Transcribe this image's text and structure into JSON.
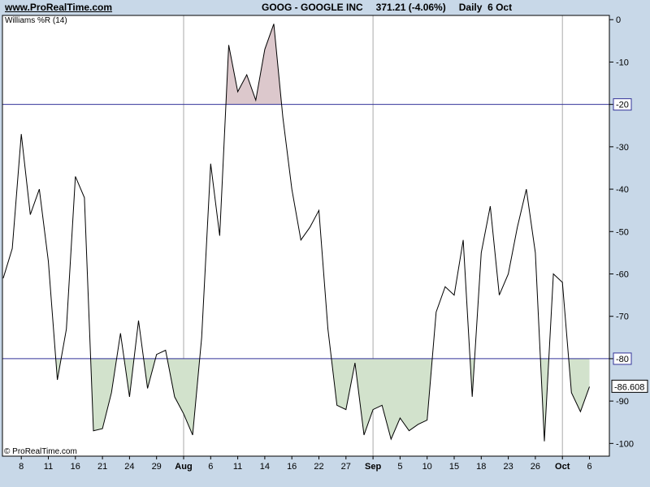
{
  "header": {
    "site": "www.ProRealTime.com",
    "symbol": "GOOG - GOOGLE INC",
    "price": "371.21 (-4.06%)",
    "period": "Daily  6 Oct"
  },
  "indicator_label": "Williams %R (14)",
  "copyright": "© ProRealTime.com",
  "colors": {
    "background": "#c8d8e8",
    "plot": "#ffffff",
    "line": "#000000",
    "level_line": "#333399",
    "overbought_fill": "#dcc8cc",
    "oversold_fill": "#d2e2cc"
  },
  "chart_data": {
    "type": "line",
    "title": "Williams %R (14)",
    "ylim": [
      -103,
      1
    ],
    "y_ticks": [
      0,
      -10,
      -30,
      -40,
      -50,
      -60,
      -70,
      -90,
      -100
    ],
    "level_lines": [
      -20,
      -80
    ],
    "level_labels": [
      "-20",
      "-80"
    ],
    "last_value": "-86.608",
    "x_labels": [
      "8",
      "11",
      "16",
      "21",
      "24",
      "29",
      "Aug",
      "6",
      "11",
      "14",
      "16",
      "22",
      "27",
      "Sep",
      "5",
      "10",
      "15",
      "18",
      "23",
      "26",
      "Oct",
      "6"
    ],
    "x_label_slots": [
      2,
      5,
      8,
      11,
      14,
      17,
      20,
      23,
      26,
      29,
      32,
      35,
      38,
      41,
      44,
      47,
      50,
      53,
      56,
      59,
      62,
      65
    ],
    "vertical_grid_labels": [
      "Aug",
      "Sep",
      "Oct"
    ],
    "series": [
      {
        "values": [
          -61,
          -54,
          -27,
          -46,
          -40,
          -57,
          -85,
          -73,
          -37,
          -42,
          -97,
          -96.5,
          -88,
          -74,
          -89,
          -71,
          -87,
          -79,
          -78,
          -89,
          -93,
          -98,
          -75,
          -34,
          -51,
          -6,
          -17,
          -13,
          -19,
          -7,
          -1,
          -23,
          -40,
          -52,
          -49,
          -45,
          -73,
          -91,
          -92,
          -81,
          -98,
          -92,
          -91,
          -99,
          -94,
          -97,
          -95.5,
          -94.5,
          -69,
          -63,
          -65,
          -52,
          -89,
          -55,
          -44,
          -65,
          -60,
          -49,
          -40,
          -55,
          -99.5,
          -60,
          -62,
          -88,
          -92.5,
          -86.6
        ]
      }
    ]
  }
}
